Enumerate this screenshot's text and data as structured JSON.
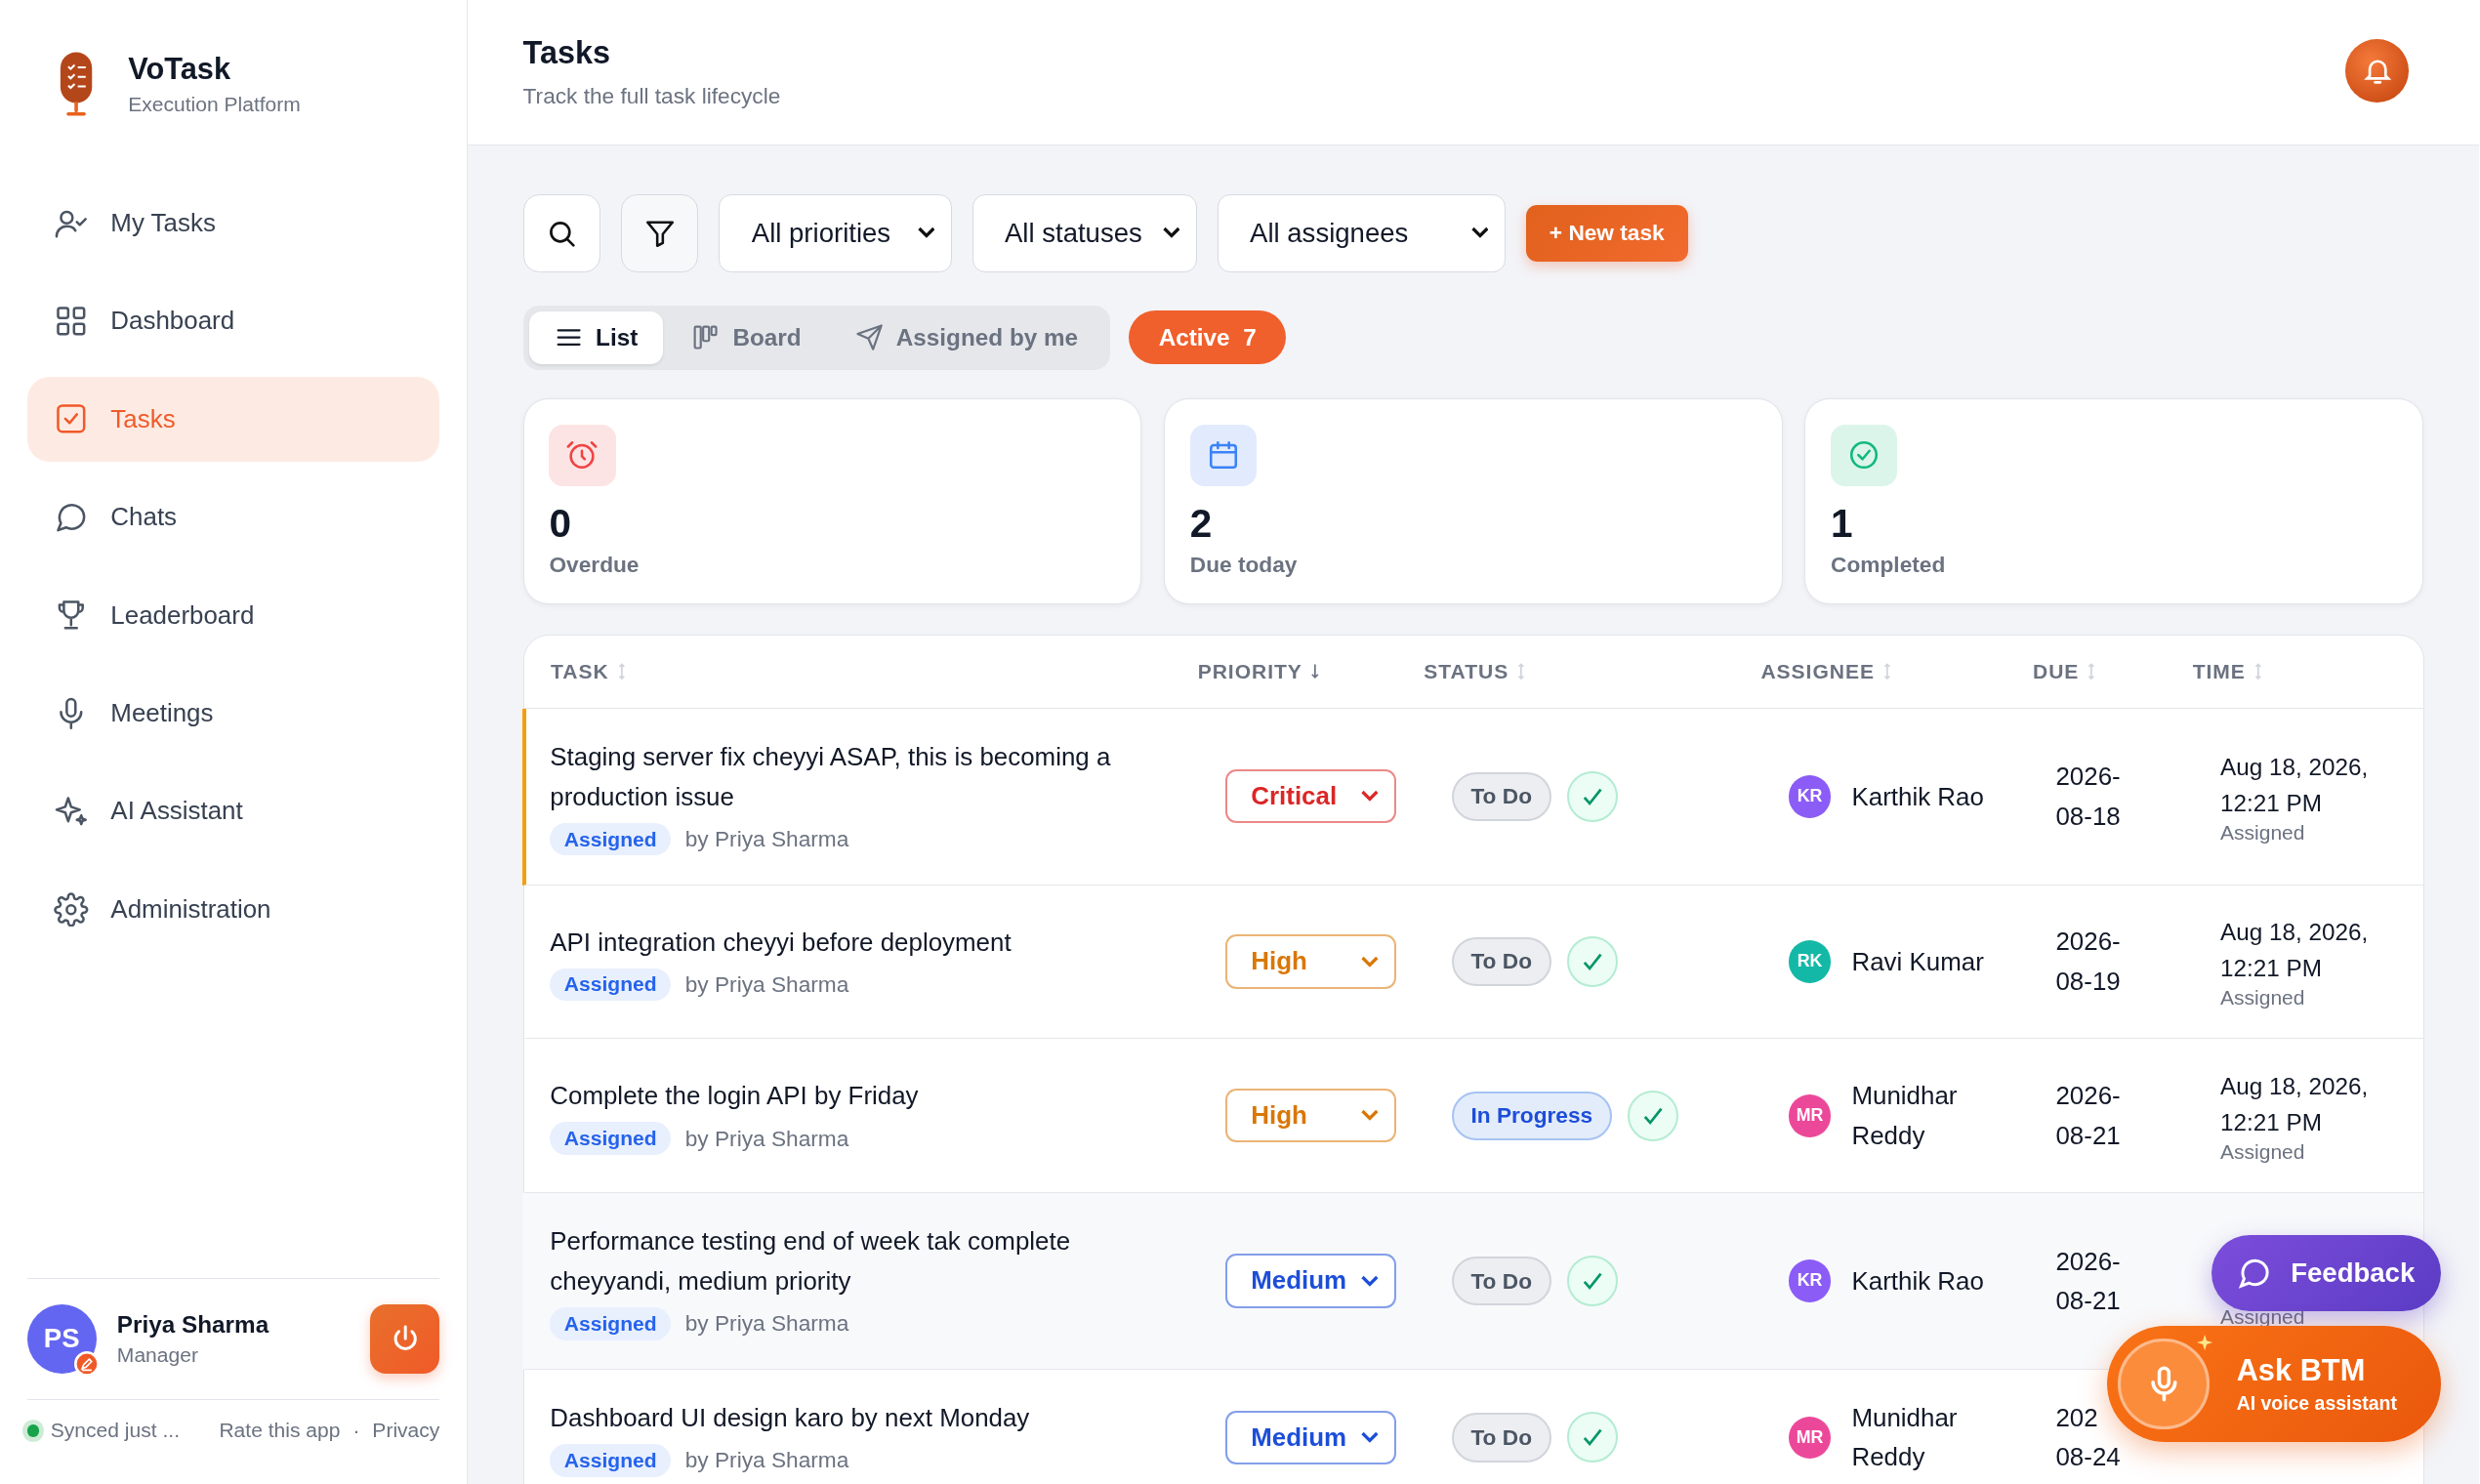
{
  "app": {
    "name": "VoTask",
    "tagline": "Execution Platform"
  },
  "nav": [
    {
      "label": "My Tasks",
      "kind": "user-check",
      "selected": false
    },
    {
      "label": "Dashboard",
      "kind": "grid",
      "selected": false
    },
    {
      "label": "Tasks",
      "kind": "check-square",
      "selected": true
    },
    {
      "label": "Chats",
      "kind": "chat",
      "selected": false
    },
    {
      "label": "Leaderboard",
      "kind": "trophy",
      "selected": false
    },
    {
      "label": "Meetings",
      "kind": "mic",
      "selected": false
    },
    {
      "label": "AI Assistant",
      "kind": "sparkle",
      "selected": false
    },
    {
      "label": "Administration",
      "kind": "gear",
      "selected": false
    }
  ],
  "user": {
    "initials": "PS",
    "name": "Priya Sharma",
    "role": "Manager"
  },
  "footer": {
    "sync_status": "Synced just ...",
    "synced": true,
    "links": [
      "Rate this app",
      "Privacy"
    ],
    "separator": "·"
  },
  "header": {
    "title": "Tasks",
    "subtitle": "Track the full task lifecycle"
  },
  "filters": [
    "All priorities",
    "All statuses",
    "All assignees"
  ],
  "new_task_button": "+ New task",
  "views": [
    {
      "label": "List",
      "kind": "list",
      "selected": true
    },
    {
      "label": "Board",
      "kind": "board",
      "selected": false
    },
    {
      "label": "Assigned by me",
      "kind": "send",
      "selected": false
    }
  ],
  "active_filter": {
    "label": "Active",
    "count": "7"
  },
  "stats": [
    {
      "kind": "overdue",
      "value": "0",
      "label": "Overdue"
    },
    {
      "kind": "due",
      "value": "2",
      "label": "Due today"
    },
    {
      "kind": "done",
      "value": "1",
      "label": "Completed"
    }
  ],
  "table": {
    "columns": [
      {
        "label": "TASK",
        "sorted": false
      },
      {
        "label": "PRIORITY",
        "sorted": true
      },
      {
        "label": "STATUS",
        "sorted": false
      },
      {
        "label": "ASSIGNEE",
        "sorted": false
      },
      {
        "label": "DUE",
        "sorted": false
      },
      {
        "label": "TIME",
        "sorted": false
      }
    ],
    "rows": [
      {
        "title": "Staging server fix cheyyi ASAP, this is becoming a production issue",
        "tag": "Assigned",
        "assigned_by": "by Priya Sharma",
        "priority": {
          "label": "Critical",
          "color": "#dc2626"
        },
        "status": {
          "label": "To Do",
          "kind": "todo"
        },
        "assignee": {
          "initials": "KR",
          "name": "Karthik Rao",
          "color": "#8b5cf6"
        },
        "due": [
          "2026-",
          "08-18"
        ],
        "time": "Aug 18, 2026, 12:21 PM",
        "time_note": "Assigned",
        "highlighted": true,
        "hovered": false
      },
      {
        "title": "API integration cheyyi before deployment",
        "tag": "Assigned",
        "assigned_by": "by Priya Sharma",
        "priority": {
          "label": "High",
          "color": "#d97706"
        },
        "status": {
          "label": "To Do",
          "kind": "todo"
        },
        "assignee": {
          "initials": "RK",
          "name": "Ravi Kumar",
          "color": "#14b8a6"
        },
        "due": [
          "2026-",
          "08-19"
        ],
        "time": "Aug 18, 2026, 12:21 PM",
        "time_note": "Assigned",
        "highlighted": false,
        "hovered": false
      },
      {
        "title": "Complete the login API by Friday",
        "tag": "Assigned",
        "assigned_by": "by Priya Sharma",
        "priority": {
          "label": "High",
          "color": "#d97706"
        },
        "status": {
          "label": "In Progress",
          "kind": "in_progress"
        },
        "assignee": {
          "initials": "MR",
          "name": "Munidhar Reddy",
          "color": "#ec4899"
        },
        "due": [
          "2026-",
          "08-21"
        ],
        "time": "Aug 18, 2026, 12:21 PM",
        "time_note": "Assigned",
        "highlighted": false,
        "hovered": false
      },
      {
        "title": "Performance testing end of week tak complete cheyyandi, medium priority",
        "tag": "Assigned",
        "assigned_by": "by Priya Sharma",
        "priority": {
          "label": "Medium",
          "color": "#1d4ed8"
        },
        "status": {
          "label": "To Do",
          "kind": "todo"
        },
        "assignee": {
          "initials": "KR",
          "name": "Karthik Rao",
          "color": "#8b5cf6"
        },
        "due": [
          "2026-",
          "08-21"
        ],
        "time_note": "Assigned",
        "highlighted": false,
        "hovered": true
      },
      {
        "title": "Dashboard UI design karo by next Monday",
        "tag": "Assigned",
        "assigned_by": "by Priya Sharma",
        "priority": {
          "label": "Medium",
          "color": "#1d4ed8"
        },
        "status": {
          "label": "To Do",
          "kind": "todo"
        },
        "assignee": {
          "initials": "MR",
          "name": "Munidhar Reddy",
          "color": "#ec4899"
        },
        "due": [
          "202",
          "08-24"
        ],
        "highlighted": false,
        "hovered": false
      }
    ]
  },
  "feedback_button": "Feedback",
  "voice_assistant": {
    "title": "Ask BTM",
    "subtitle": "AI voice assistant"
  }
}
